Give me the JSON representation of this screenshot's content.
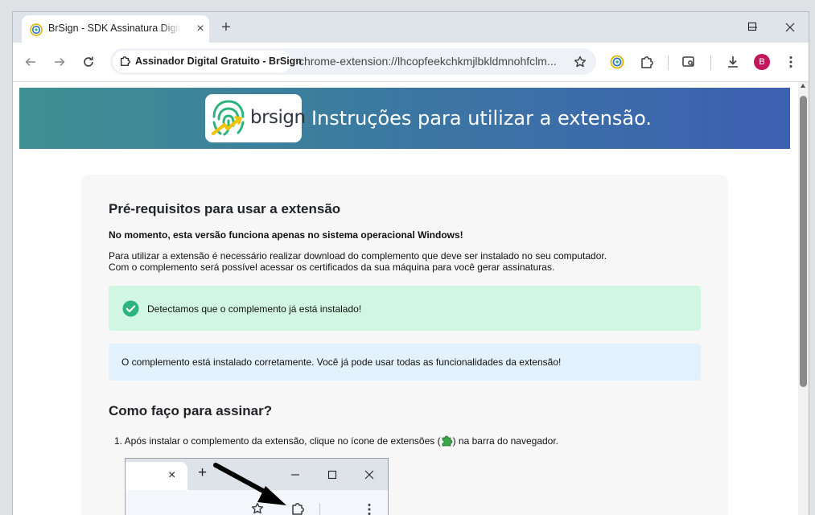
{
  "browser": {
    "tab_title": "BrSign - SDK Assinatura Digital",
    "tab_close": "×",
    "new_tab": "+",
    "site_chip": "Assinador Digital Gratuito - BrSign",
    "url": "chrome-extension://lhcopfeekchkmjlbkldmnohfclm...",
    "avatar_letter": "B"
  },
  "hero": {
    "logo_text": "brsign",
    "title": "Instruções para utilizar a extensão."
  },
  "prereq": {
    "heading": "Pré-requisitos para usar a extensão",
    "bold_note": "No momento, esta versão funciona apenas no sistema operacional Windows!",
    "line1": "Para utilizar a extensão é necessário realizar download do complemento que deve ser instalado no seu computador.",
    "line2": "Com o complemento será possível acessar os certificados da sua máquina para você gerar assinaturas.",
    "success_alert": "Detectamos que o complemento já está instalado!",
    "info_alert": "O complemento está instalado corretamente. Você já pode usar todas as funcionalidades da extensão!"
  },
  "howto": {
    "heading": "Como faço para assinar?",
    "step1_before": "1. Após instalar o complemento da extensão, clique no ícone de extensões (",
    "step1_after": ") na barra do navegador.",
    "mini_close": "×",
    "mini_new_tab": "+"
  },
  "colors": {
    "accent_green": "#2db47d",
    "success_bg": "#d1f7e3",
    "info_bg": "#e3f1fd",
    "avatar": "#c2185b"
  }
}
